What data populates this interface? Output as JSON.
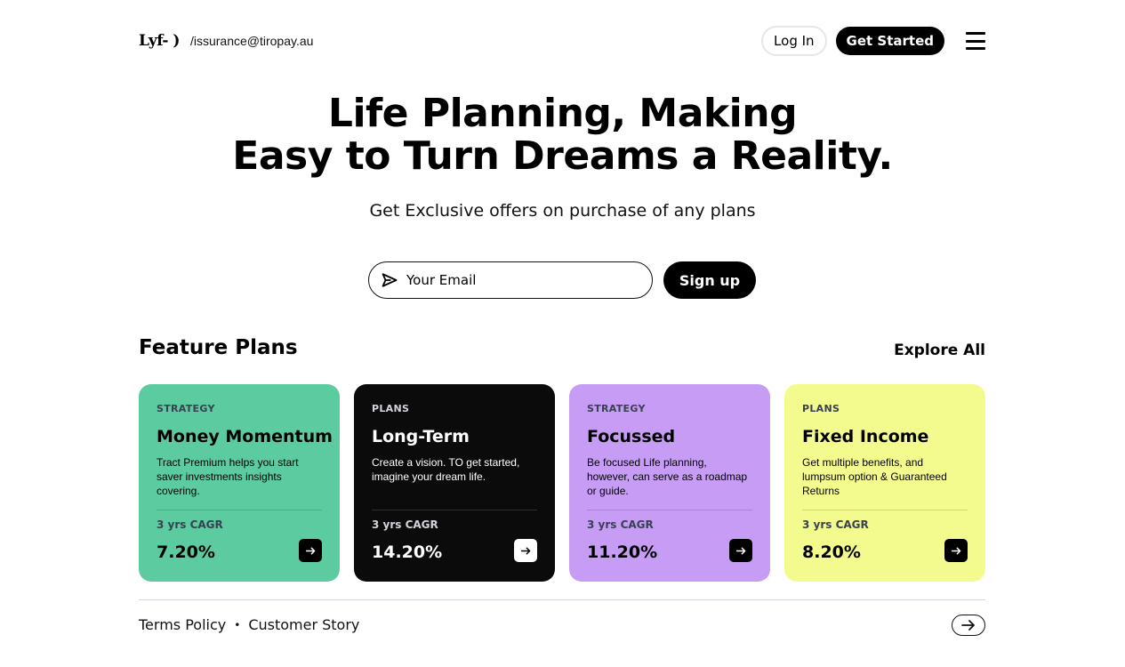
{
  "header": {
    "logo": "Lyf- )",
    "contact": "/issurance@tiropay.au",
    "login_label": "Log In",
    "get_started_label": "Get Started",
    "menu_icon": "hamburger-menu-icon"
  },
  "hero": {
    "title_line1": "Life Planning, Making",
    "title_line2": "Easy to Turn Dreams a Reality.",
    "subtitle": "Get Exclusive offers on purchase of any plans",
    "email_placeholder": "Your Email",
    "email_icon": "send-icon",
    "signup_label": "Sign up"
  },
  "plans": {
    "section_title": "Feature Plans",
    "explore_label": "Explore All",
    "cards": [
      {
        "tag": "STRATEGY",
        "title": "Money Momentum",
        "description": "Tract Premium helps you start saver investments insights covering.",
        "cagr_label": "3 yrs CAGR",
        "rate": "7.20%",
        "color": "#5ccba0",
        "icon": "arrow-right-icon"
      },
      {
        "tag": "PLANS",
        "title": "Long-Term",
        "description": "Create a vision. TO get started, imagine your dream life.",
        "cagr_label": "3 yrs CAGR",
        "rate": "14.20%",
        "color": "#0b0b0b",
        "icon": "arrow-right-icon"
      },
      {
        "tag": "STRATEGY",
        "title": "Focussed",
        "description": "Be focused Life planning, however, can serve as a roadmap or guide.",
        "cagr_label": "3 yrs CAGR",
        "rate": "11.20%",
        "color": "#c79cf5",
        "icon": "arrow-right-icon"
      },
      {
        "tag": "PLANS",
        "title": "Fixed Income",
        "description": "Get multiple benefits, and lumpsum option & Guaranteed Returns",
        "cagr_label": "3 yrs CAGR",
        "rate": "8.20%",
        "color": "#f4fb8e",
        "icon": "arrow-right-icon"
      }
    ]
  },
  "footer": {
    "terms_label": "Terms Policy",
    "separator": "•",
    "story_label": "Customer Story",
    "arrow_icon": "arrow-right-circle-icon"
  }
}
